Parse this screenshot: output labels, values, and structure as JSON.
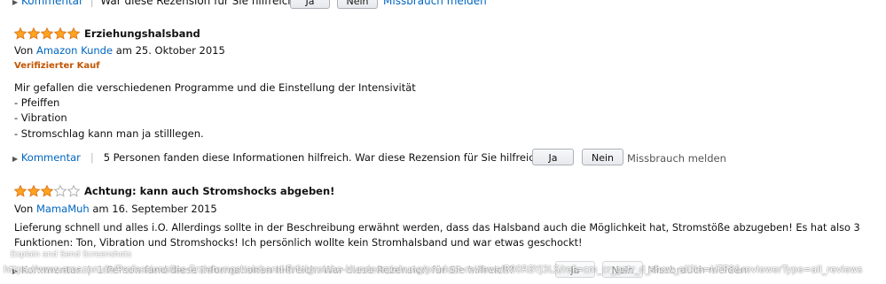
{
  "top_row": {
    "comment_label": "Kommentar",
    "helpful_question": "War diese Rezension für Sie hilfreich?",
    "yes_label": "Ja",
    "no_label": "Nein",
    "report_label": "Missbrauch melden"
  },
  "reviews": [
    {
      "rating": 5,
      "title": "Erziehungshalsband",
      "by_prefix": "Von",
      "author": "Amazon Kunde",
      "date_text": "am 25. Oktober 2015",
      "verified": "Verifizierter Kauf",
      "body": [
        "Mir gefallen die verschiedenen Programme und die Einstellung der Intensivität",
        "- Pfeiffen",
        "- Vibration",
        "- Stromschlag kann man ja stilllegen."
      ],
      "comment_label": "Kommentar",
      "helpful_text": "5 Personen fanden diese Informationen hilfreich. War diese Rezension für Sie hilfreich?",
      "yes_label": "Ja",
      "no_label": "Nein",
      "report_label": "Missbrauch melden"
    },
    {
      "rating": 3,
      "title": "Achtung: kann auch Stromshocks abgeben!",
      "by_prefix": "Von",
      "author": "MamaMuh",
      "date_text": "am 16. September 2015",
      "body": [
        "Lieferung schnell und alles i.O. Allerdings sollte in der Beschreibung erwähnt werden, dass das Halsband auch die Möglichkeit hat, Stromstöße abzugeben! Es hat also 3",
        "Funktionen: Ton, Vibration und Stromshocks! Ich persönlich wollte kein Stromhalsband und war etwas geschockt!"
      ],
      "comment_label": "Kommentar",
      "helpful_text": "1 Person fand diese Informationen hilfreich. War diese Rezension für Sie hilfreich?",
      "yes_label": "Ja",
      "no_label": "Nein",
      "report_label": "Missbrauch melden"
    }
  ],
  "overlay": {
    "tooltip": "Explain and Send Screenshots",
    "url": "https://www.amazon.de/Professionelles-Erziehungshalsband-Erfolgreiche-Hundeerziehung/product-reviews/B00RBYJ3LS/ref=cm_cr_getr_d_show_all?ie=UTF8&reviewerType=all_reviews"
  },
  "colors": {
    "link": "#0066c0",
    "star_fill": "#ffa41c",
    "star_stroke": "#de7921",
    "verified": "#c45500"
  }
}
